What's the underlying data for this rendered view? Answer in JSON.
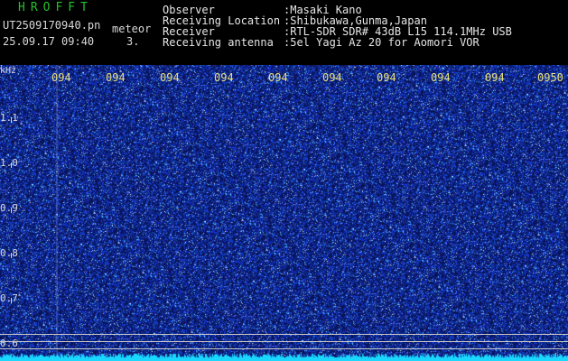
{
  "header": {
    "app_title": "HROFFT",
    "file_name": "UT2509170940.pn",
    "mode": "meteor",
    "timestamp": "25.09.17 09:40",
    "count": "3."
  },
  "info": [
    {
      "label": "Observer",
      "value": ":Masaki Kano"
    },
    {
      "label": "Receiving Location",
      "value": ":Shibukawa,Gunma,Japan"
    },
    {
      "label": "Receiver",
      "value": ":RTL-SDR SDR# 43dB L15 114.1MHz USB"
    },
    {
      "label": "Receiving antenna",
      "value": ":5el Yagi Az 20 for Aomori VOR"
    }
  ],
  "axis": {
    "y_unit": "kHz",
    "time_ticks": [
      "094",
      "094",
      "094",
      "094",
      "094",
      "094",
      "094",
      "094",
      "094",
      "0950"
    ],
    "freq_ticks": [
      "1.1",
      "1.0",
      "0.9",
      "0.8",
      "0.7",
      "0.6"
    ]
  },
  "colors": {
    "background": "#07125a",
    "noise": "#2a3cff",
    "title": "#22c22a",
    "tick": "#e8e07a",
    "baseline": "#19d7ff"
  }
}
